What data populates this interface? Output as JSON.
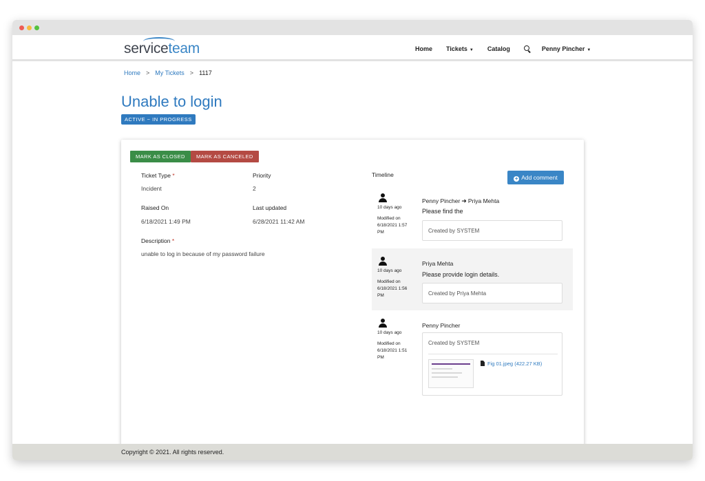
{
  "brand": {
    "logo_left": "service",
    "logo_right": "team"
  },
  "nav": {
    "home": "Home",
    "tickets": "Tickets",
    "catalog": "Catalog",
    "user": "Penny Pincher"
  },
  "breadcrumb": {
    "home": "Home",
    "my_tickets": "My Tickets",
    "current": "1117",
    "sep": ">"
  },
  "ticket": {
    "title": "Unable to login",
    "status": "ACTIVE ~ IN PROGRESS",
    "actions": {
      "close": "MARK AS CLOSED",
      "cancel": "MARK AS CANCELED"
    },
    "fields": {
      "type_label": "Ticket Type",
      "type_value": "Incident",
      "priority_label": "Priority",
      "priority_value": "2",
      "raised_label": "Raised On",
      "raised_value": "6/18/2021 1:49 PM",
      "updated_label": "Last updated",
      "updated_value": "6/28/2021 11:42 AM",
      "description_label": "Description",
      "description_value": "unable to log in because of my password failure",
      "required_mark": "*"
    }
  },
  "timeline": {
    "label": "Timeline",
    "add_comment": "Add comment",
    "entries": [
      {
        "ago": "10 days ago",
        "modified": "Modified on 6/18/2021 1:57 PM",
        "from": "Penny Pincher",
        "to": "Priya Mehta",
        "message": "Please find the",
        "created_by": "Created by SYSTEM"
      },
      {
        "ago": "10 days ago",
        "modified": "Modified on 6/18/2021 1:56 PM",
        "from": "Priya Mehta",
        "message": "Please provide login details.",
        "created_by": "Created by Priya Mehta"
      },
      {
        "ago": "10 days ago",
        "modified": "Modified on 6/18/2021 1:51 PM",
        "from": "Penny Pincher",
        "created_by": "Created by SYSTEM",
        "attachment": "Fig 01.jpeg (422.27 KB)"
      }
    ]
  },
  "footer": {
    "copyright": "Copyright © 2021. All rights reserved."
  },
  "colors": {
    "accent": "#2f7abf",
    "success": "#3a8d47",
    "danger": "#b44a43"
  }
}
